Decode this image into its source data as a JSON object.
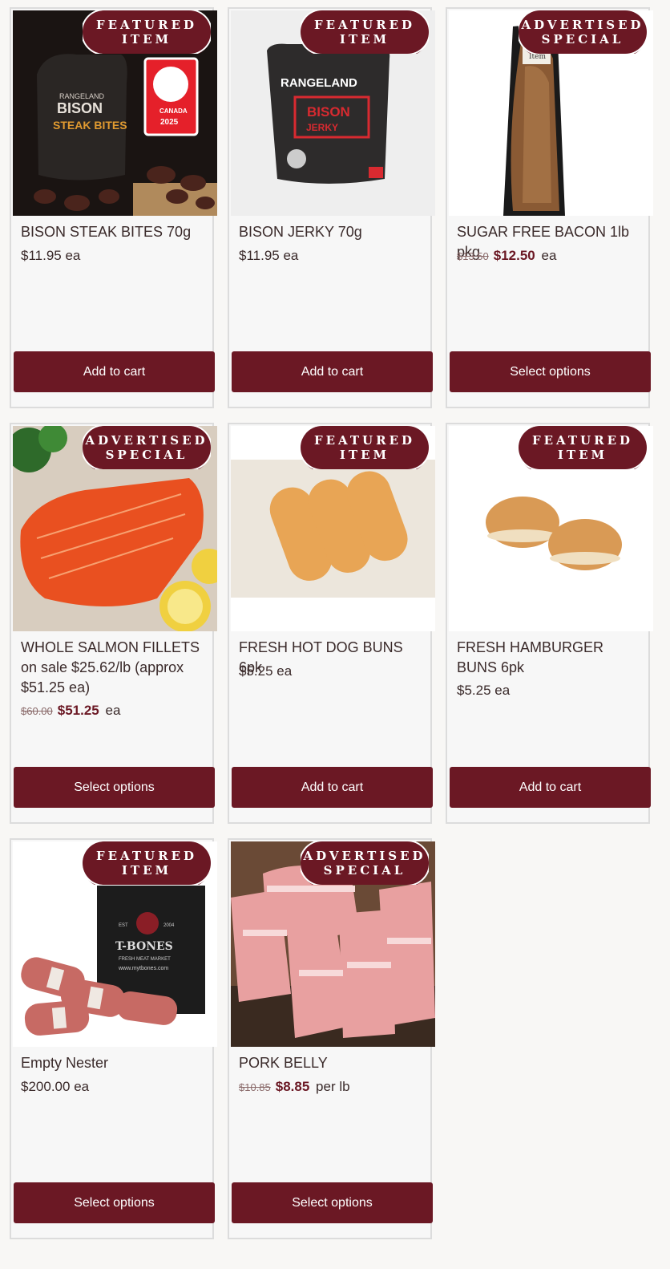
{
  "products": [
    {
      "badge": [
        "FEATURED",
        "ITEM"
      ],
      "title": "BISON STEAK BITES 70g",
      "price": "$11.95",
      "old_price": "",
      "sale_price": "",
      "unit": "ea",
      "button": "Add to cart"
    },
    {
      "badge": [
        "FEATURED",
        "ITEM"
      ],
      "title": "BISON JERKY 70g",
      "price": "$11.95",
      "old_price": "",
      "sale_price": "",
      "unit": "ea",
      "button": "Add to cart"
    },
    {
      "badge": [
        "ADVERTISED",
        "SPECIAL"
      ],
      "title": "SUGAR FREE BACON 1lb pkg",
      "price": "",
      "old_price": "$13.50",
      "sale_price": "$12.50",
      "unit": "ea",
      "button": "Select options"
    },
    {
      "badge": [
        "ADVERTISED",
        "SPECIAL"
      ],
      "title": "WHOLE SALMON FILLETS on sale $25.62/lb (approx $51.25 ea)",
      "price": "",
      "old_price": "$60.00",
      "sale_price": "$51.25",
      "unit": "ea",
      "button": "Select options"
    },
    {
      "badge": [
        "FEATURED",
        "ITEM"
      ],
      "title": "FRESH HOT DOG BUNS 6pk",
      "price": "$5.25",
      "old_price": "",
      "sale_price": "",
      "unit": "ea",
      "button": "Add to cart"
    },
    {
      "badge": [
        "FEATURED",
        "ITEM"
      ],
      "title": "FRESH HAMBURGER BUNS 6pk",
      "price": "$5.25",
      "old_price": "",
      "sale_price": "",
      "unit": "ea",
      "button": "Add to cart"
    },
    {
      "badge": [
        "FEATURED",
        "ITEM"
      ],
      "title": "Empty Nester",
      "price": "$200.00",
      "old_price": "",
      "sale_price": "",
      "unit": "ea",
      "button": "Select options"
    },
    {
      "badge": [
        "ADVERTISED",
        "SPECIAL"
      ],
      "title": "PORK BELLY",
      "price": "",
      "old_price": "$10.85",
      "sale_price": "$8.85",
      "unit": "per lb",
      "button": "Select options"
    }
  ],
  "image_text": {
    "bites_bag": [
      "RANGELAND",
      "BISON",
      "STEAK BITES"
    ],
    "bites_award": [
      "CANADA",
      "2025"
    ],
    "jerky_bag": [
      "RANGELAND",
      "BISON",
      "JERKY"
    ],
    "bacon_label": "Item",
    "tbones_bag": [
      "EST",
      "2004",
      "T-BONES",
      "FRESH MEAT MARKET",
      "www.mytbones.com"
    ]
  },
  "colors": {
    "brand": "#6b1824",
    "card_bg": "#f7f7f7",
    "page_bg": "#f8f7f5"
  }
}
